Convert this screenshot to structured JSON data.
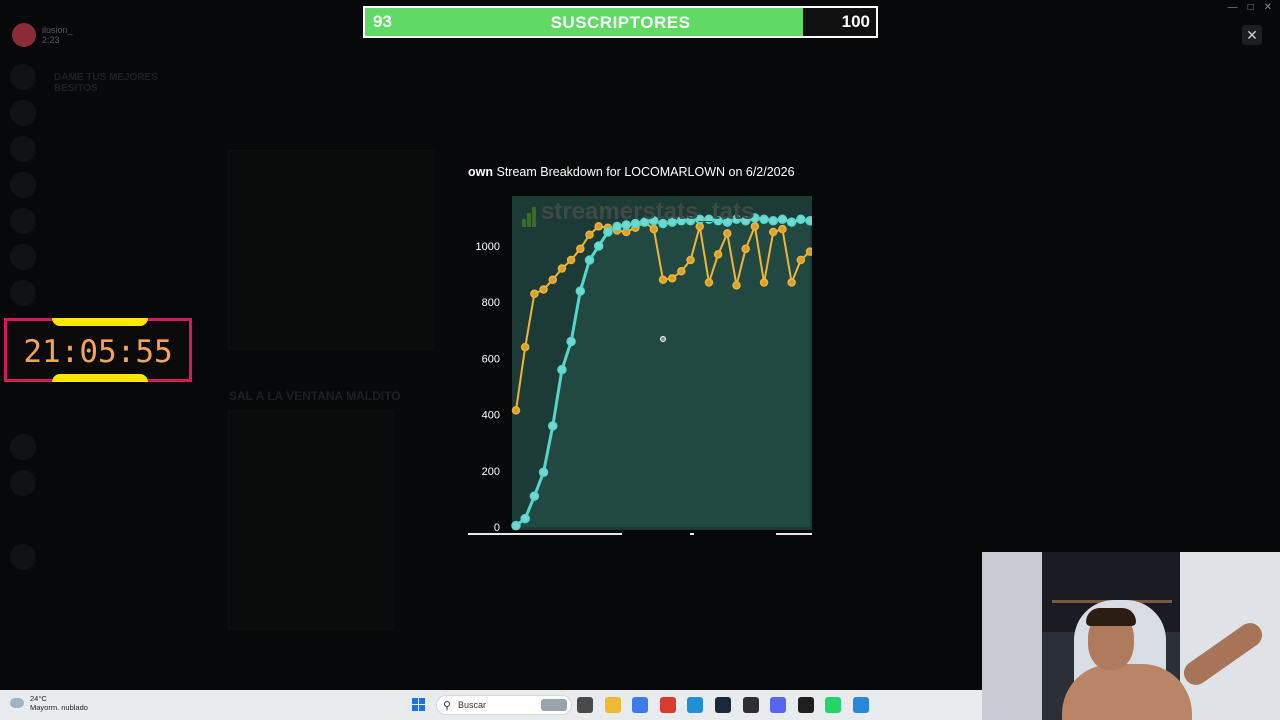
{
  "subscribers": {
    "current": "93",
    "label": "SUSCRIPTORES",
    "goal": "100",
    "progress": 0.93,
    "fill_color": "#61d965"
  },
  "timer": {
    "text": "21:05:55",
    "frame_color": "#d11c5b",
    "accent_color": "#ffe600"
  },
  "discord": {
    "user_name": "ilusion_",
    "user_status": "2:23",
    "channel_heading": "DAME TUS MEJORES BESITOS",
    "message_heading": "SAL A LA VENTANA MALDITO"
  },
  "chart_title": {
    "lead": "own",
    "text": "Stream Breakdown for LOCOMARLOWN on 6/2/2026"
  },
  "watermark": "streamerstats_tats",
  "chart_data": {
    "type": "line",
    "title": "Stream Breakdown for LOCOMARLOWN on 6/2/2026",
    "xlabel": "",
    "ylabel": "",
    "ylim": [
      0,
      1200
    ],
    "yticks": [
      "0",
      "200",
      "400",
      "600",
      "800",
      "1000"
    ],
    "grid": false,
    "legend": "none",
    "plot_background": "#1c3b36",
    "series": [
      {
        "color": "#f0b43a",
        "x": [
          0,
          1,
          2,
          3,
          4,
          5,
          6,
          7,
          8,
          9,
          10,
          11,
          12,
          13,
          14,
          15,
          16,
          17,
          18,
          19,
          20,
          21,
          22,
          23,
          24,
          25,
          26,
          27,
          28,
          29,
          30,
          31,
          32
        ],
        "values": [
          415,
          640,
          830,
          845,
          880,
          920,
          950,
          990,
          1040,
          1070,
          1065,
          1055,
          1050,
          1065,
          1085,
          1060,
          880,
          885,
          910,
          950,
          1070,
          870,
          970,
          1045,
          860,
          990,
          1070,
          870,
          1050,
          1060,
          870,
          950,
          980
        ]
      },
      {
        "color": "#56d6cb",
        "x": [
          0,
          1,
          2,
          3,
          4,
          5,
          6,
          7,
          8,
          9,
          10,
          11,
          12,
          13,
          14,
          15,
          16,
          17,
          18,
          19,
          20,
          21,
          22,
          23,
          24,
          25,
          26,
          27,
          28,
          29,
          30,
          31,
          32
        ],
        "values": [
          5,
          30,
          110,
          195,
          360,
          560,
          660,
          840,
          950,
          1000,
          1050,
          1070,
          1075,
          1080,
          1085,
          1090,
          1080,
          1085,
          1090,
          1090,
          1095,
          1095,
          1090,
          1085,
          1095,
          1090,
          1100,
          1095,
          1090,
          1095,
          1085,
          1095,
          1090
        ]
      }
    ]
  },
  "taskbar": {
    "weather_temp": "24°C",
    "weather_desc": "Mayorm. nublado",
    "search_label": "Buscar",
    "apps": [
      "file-explorer-icon",
      "folder-icon",
      "copilot-icon",
      "office-icon",
      "edge-icon",
      "steam-icon",
      "obs-icon",
      "discord-icon",
      "notion-icon",
      "whatsapp-icon",
      "notepad-icon"
    ]
  }
}
